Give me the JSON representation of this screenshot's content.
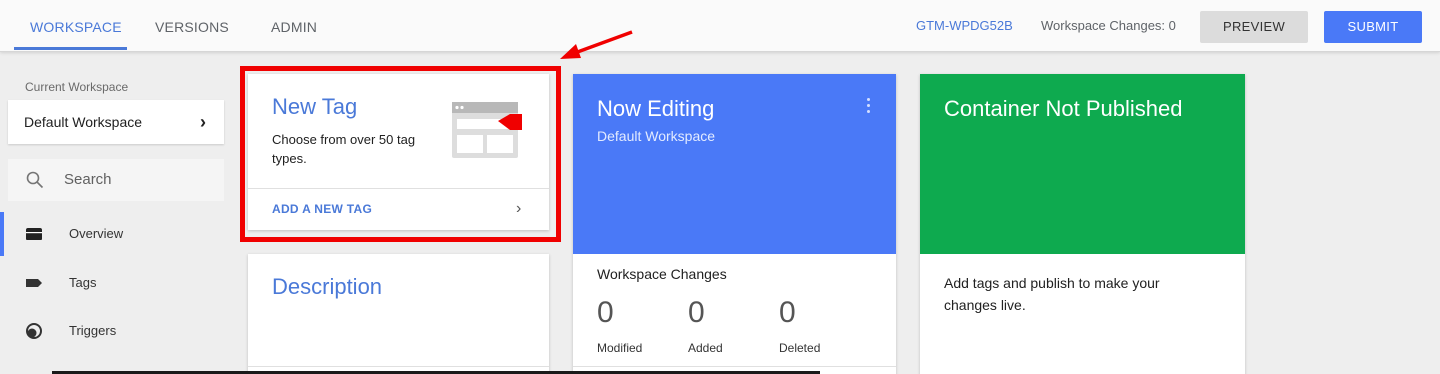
{
  "topbar": {
    "tabs": [
      {
        "label": "WORKSPACE",
        "active": true
      },
      {
        "label": "VERSIONS",
        "active": false
      },
      {
        "label": "ADMIN",
        "active": false
      }
    ],
    "container_id": "GTM-WPDG52B",
    "workspace_changes": "Workspace Changes: 0",
    "preview_label": "PREVIEW",
    "submit_label": "SUBMIT"
  },
  "sidebar": {
    "current_workspace_label": "Current Workspace",
    "workspace_name": "Default Workspace",
    "search_placeholder": "Search",
    "items": [
      {
        "label": "Overview",
        "icon": "folder-icon",
        "active": true
      },
      {
        "label": "Tags",
        "icon": "tag-icon",
        "active": false
      },
      {
        "label": "Triggers",
        "icon": "trigger-icon",
        "active": false
      }
    ]
  },
  "new_tag_card": {
    "title": "New Tag",
    "description": "Choose from over 50 tag types.",
    "link_label": "ADD A NEW TAG",
    "icon": "tag-template-icon"
  },
  "description_card": {
    "title": "Description"
  },
  "editing_card": {
    "title": "Now Editing",
    "subtitle": "Default Workspace",
    "changes_title": "Workspace Changes",
    "stats": [
      {
        "value": "0",
        "label": "Modified"
      },
      {
        "value": "0",
        "label": "Added"
      },
      {
        "value": "0",
        "label": "Deleted"
      }
    ]
  },
  "publish_card": {
    "title": "Container Not Published",
    "text": "Add tags and publish to make your changes live."
  },
  "colors": {
    "accent": "#4a79f7",
    "link": "#4a79d8",
    "published_green": "#0eaa4f",
    "annotation_red": "#f00000"
  }
}
